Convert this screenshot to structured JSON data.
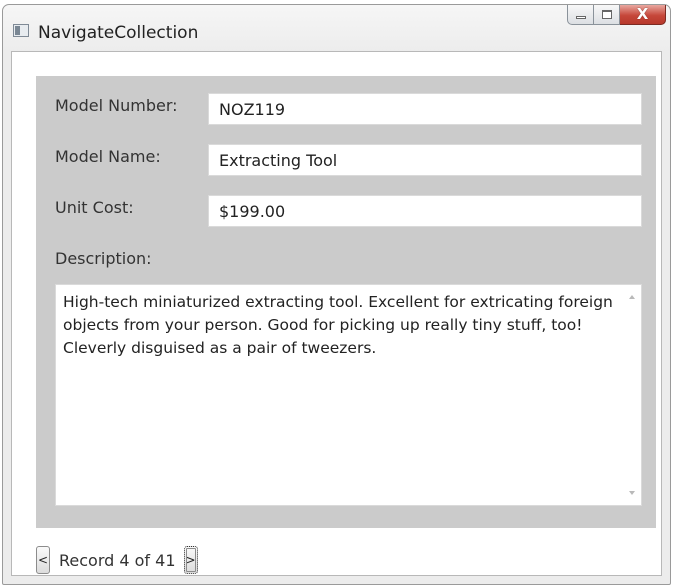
{
  "window": {
    "title": "NavigateCollection",
    "close_glyph": "X"
  },
  "form": {
    "model_number": {
      "label": "Model Number:",
      "value": "NOZ119"
    },
    "model_name": {
      "label": "Model Name:",
      "value": "Extracting Tool"
    },
    "unit_cost": {
      "label": "Unit Cost:",
      "value": "$199.00"
    },
    "description": {
      "label": "Description:",
      "value": "High-tech miniaturized extracting tool. Excellent for extricating foreign objects from your person. Good for picking up really tiny stuff, too! Cleverly disguised as a pair of tweezers."
    }
  },
  "navigation": {
    "prev_label": "<",
    "next_label": ">",
    "record_text": "Record 4 of 41"
  }
}
